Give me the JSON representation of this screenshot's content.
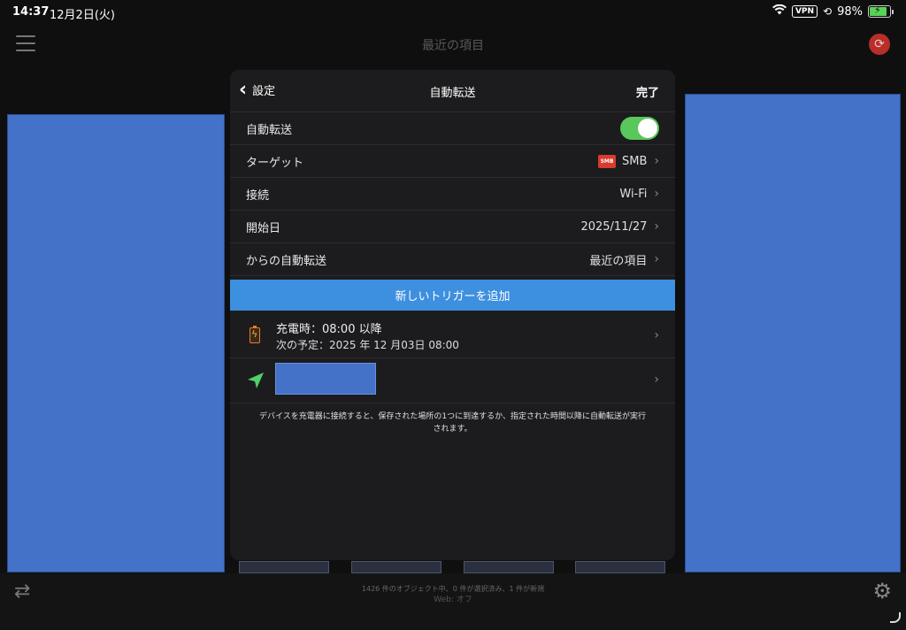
{
  "status": {
    "time": "14:37",
    "date": "12月2日(火)",
    "vpn": "VPN",
    "battery_pct": "98%"
  },
  "app": {
    "title": "最近の項目"
  },
  "modal": {
    "back_label": "設定",
    "title": "自動転送",
    "done_label": "完了",
    "rows": [
      {
        "label": "自動転送",
        "value": ""
      },
      {
        "label": "ターゲット",
        "value": "SMB"
      },
      {
        "label": "接続",
        "value": "Wi-Fi"
      },
      {
        "label": "開始日",
        "value": "2025/11/27"
      },
      {
        "label": "からの自動転送",
        "value": "最近の項目"
      }
    ],
    "auto_transfer_on": true,
    "smb_icon_text": "SMB",
    "add_trigger_label": "新しいトリガーを追加",
    "charge_trigger": {
      "line1": "充電時：08:00 以降",
      "line2": "次の予定：2025 年 12 月03日 08:00"
    },
    "footer_note": "デバイスを充電器に接続すると、保存された場所の1つに到達するか、指定された時間以降に自動転送が実行されます。"
  },
  "bottom": {
    "info": "1426 件のオブジェクト中、0 件が選択済み、1 件が新規",
    "web": "Web: オフ"
  },
  "colors": {
    "toggle_on": "#5ac75c",
    "add_trigger_bg": "#3d8fdf",
    "placeholder_blue": "#4472c8",
    "sync_red": "#b82e28"
  }
}
